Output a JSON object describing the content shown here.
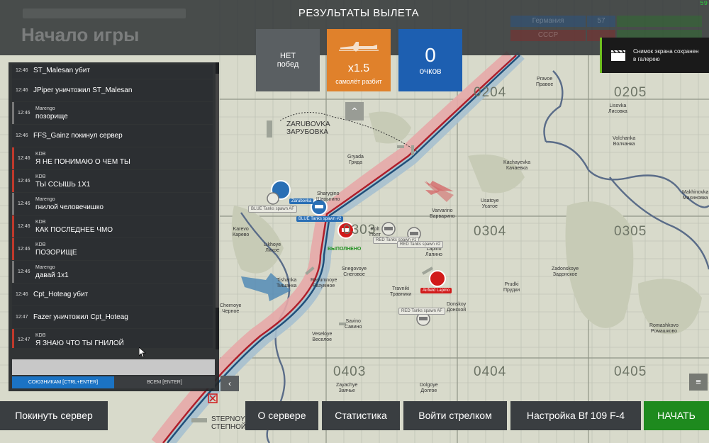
{
  "fps": "59",
  "game_title": "Начало игры",
  "result": {
    "title": "РЕЗУЛЬТАТЫ ВЫЛЕТА",
    "wins_line1": "НЕТ",
    "wins_line2": "побед",
    "crash_multiplier": "x1.5",
    "crash_label": "самолёт разбит",
    "points_value": "0",
    "points_label": "очков"
  },
  "scoreboard": {
    "row1": [
      "Германия",
      "57",
      ""
    ],
    "row2": [
      "СССР",
      "",
      ""
    ]
  },
  "toast": {
    "line1": "Снимок экрана сохранен",
    "line2": "в галерею"
  },
  "chat": {
    "messages": [
      {
        "time": "12:46",
        "user": "",
        "text": "ST_Malesan убит",
        "kind": "system"
      },
      {
        "time": "12:46",
        "user": "",
        "text": "JPiper уничтожил ST_Malesan",
        "kind": "system"
      },
      {
        "time": "12:46",
        "user": "Marengo",
        "text": "позорище",
        "kind": "m"
      },
      {
        "time": "12:46",
        "user": "",
        "text": "FFS_Gainz покинул сервер",
        "kind": "system"
      },
      {
        "time": "12:46",
        "user": "KDB",
        "text": "Я НЕ ПОНИМАЮ О ЧЕМ ТЫ",
        "kind": "k"
      },
      {
        "time": "12:46",
        "user": "KDB",
        "text": "ТЫ  ССЫШЬ 1Х1",
        "kind": "k"
      },
      {
        "time": "12:46",
        "user": "Marengo",
        "text": "гнилой человечишко",
        "kind": "m"
      },
      {
        "time": "12:46",
        "user": "KDB",
        "text": "КАК ПОСЛЕДНЕЕ ЧМО",
        "kind": "k"
      },
      {
        "time": "12:46",
        "user": "KDB",
        "text": "ПОЗОРИЩЕ",
        "kind": "k"
      },
      {
        "time": "12:46",
        "user": "Marengo",
        "text": "давай 1х1",
        "kind": "m"
      },
      {
        "time": "12:46",
        "user": "",
        "text": "Cpt_Hoteag убит",
        "kind": "system"
      },
      {
        "time": "12:47",
        "user": "",
        "text": "Fazer уничтожил Cpt_Hoteag",
        "kind": "system"
      },
      {
        "time": "12:47",
        "user": "KDB",
        "text": "Я ЗНАЮ ЧТО ТЫ ГНИЛОЙ",
        "kind": "k"
      }
    ],
    "team_button": "СОЮЗНИКАМ [CTRL+ENTER]",
    "all_button": "ВСЕМ [ENTER]"
  },
  "map": {
    "grid_labels": [
      "0204",
      "0205",
      "0303",
      "0304",
      "0305",
      "0403",
      "0404",
      "0405"
    ],
    "towns": [
      {
        "en": "ZARUBOVKA",
        "ru": "ЗАРУБОВКА"
      },
      {
        "en": "STEPNOY",
        "ru": "СТЕПНОЙ"
      },
      {
        "en": "Gryada",
        "ru": "Гряда"
      },
      {
        "en": "Kachayevka",
        "ru": "Качаевка"
      },
      {
        "en": "Sharygino",
        "ru": "Шарыгино"
      },
      {
        "en": "Varvarino",
        "ru": "Варварино"
      },
      {
        "en": "Usatoye",
        "ru": "Усатое"
      },
      {
        "en": "Karevo",
        "ru": "Карево"
      },
      {
        "en": "Likhoye",
        "ru": "Лихое"
      },
      {
        "en": "Tishanka",
        "ru": "Тишанка"
      },
      {
        "en": "Rasumnoye",
        "ru": "Разумное"
      },
      {
        "en": "Snegovoye",
        "ru": "Снеговое"
      },
      {
        "en": "Travniki",
        "ru": "Травники"
      },
      {
        "en": "Lapino",
        "ru": "Лапино"
      },
      {
        "en": "Prudki",
        "ru": "Прудки"
      },
      {
        "en": "Donskoy",
        "ru": "Донской"
      },
      {
        "en": "Zadonskoye",
        "ru": "Задонское"
      },
      {
        "en": "Savino",
        "ru": "Савино"
      },
      {
        "en": "Veseloye",
        "ru": "Веселое"
      },
      {
        "en": "Zayachye",
        "ru": "Заячье"
      },
      {
        "en": "Dolgoye",
        "ru": "Долгое"
      },
      {
        "en": "Romashkovo",
        "ru": "Ромашково"
      },
      {
        "en": "Volchanka",
        "ru": "Волчанка"
      },
      {
        "en": "Lisovka",
        "ru": "Лисовка"
      },
      {
        "en": "Makhinovka",
        "ru": "Махиновка"
      },
      {
        "en": "Pravoe",
        "ru": "Правое"
      },
      {
        "en": "Chernoye",
        "ru": "Черное"
      },
      {
        "en": "Polt",
        "ru": "Полт"
      }
    ],
    "markers": {
      "blue_spawn_1": "BLUE Tanks spawn AF",
      "blue_spawn_2": "BLUE Tanks spawn #2",
      "red_spawn_1": "RED Tanks spawn #1",
      "red_spawn_2": "RED Tanks spawn #2",
      "red_spawn_af": "RED Tanks spawn AF",
      "airfield": "Airfield Lapino",
      "objective": "ВЫПОЛНЕНО",
      "blue_base_label": "Zarubovka"
    }
  },
  "buttons": {
    "leave": "Покинуть сервер",
    "about": "О сервере",
    "stats": "Статистика",
    "gunner": "Войти стрелком",
    "setup": "Настройка Bf 109 F-4",
    "start": "НАЧАТЬ"
  },
  "colors": {
    "accent_orange": "#e0812b",
    "accent_blue": "#1d5fb1",
    "start_green": "#1e8a1e"
  }
}
